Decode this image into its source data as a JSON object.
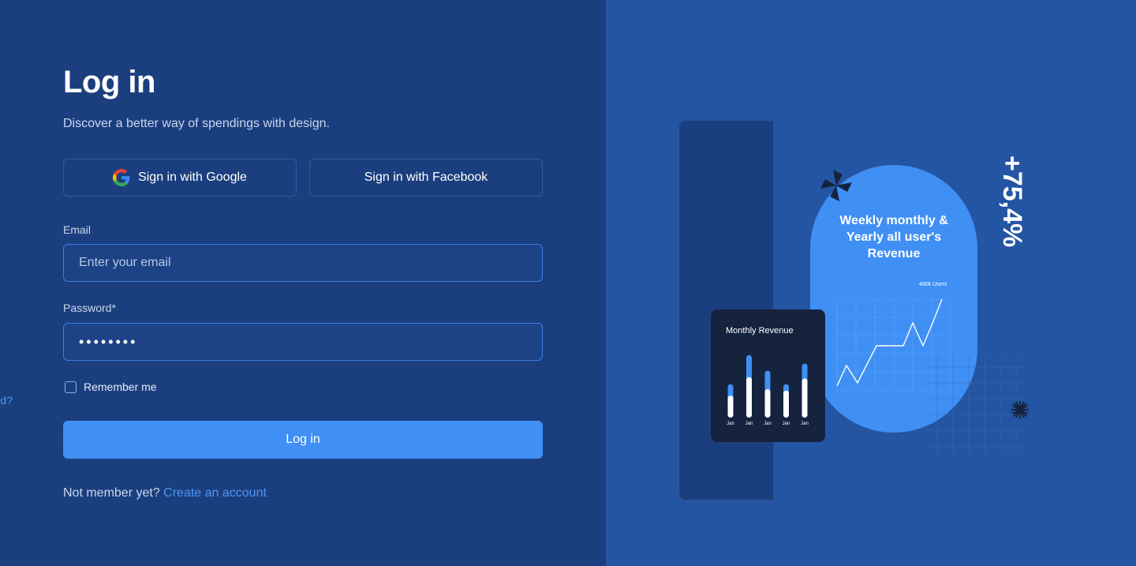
{
  "login": {
    "title": "Log in",
    "subtitle": "Discover a better way of spendings with design.",
    "google_label": "Sign in with Google",
    "facebook_label": "Sign in with Facebook",
    "email_label": "Email",
    "email_placeholder": "Enter your email",
    "password_label": "Password*",
    "password_value": "••••••••",
    "remember_label": "Remember me",
    "remember_checked": false,
    "forgot_label": "Forget password?",
    "submit_label": "Log in",
    "signup_prompt": "Not member yet?",
    "signup_link": "Create an account"
  },
  "illustration": {
    "growth": "+75,4%",
    "pill_title_lines": [
      "Weekly monthly &",
      "Yearly all user's",
      "Revenue"
    ],
    "pill_tag": "480k Users",
    "card_title": "Monthly Revenue",
    "card_bars": [
      {
        "label": "Jan",
        "total": 0.47,
        "white": 0.31
      },
      {
        "label": "Jan",
        "total": 0.88,
        "white": 0.57
      },
      {
        "label": "Jan",
        "total": 0.66,
        "white": 0.4
      },
      {
        "label": "Jan",
        "total": 0.47,
        "white": 0.38
      },
      {
        "label": "Jan",
        "total": 0.76,
        "white": 0.55
      }
    ]
  },
  "colors": {
    "left_bg": "#1b3f7e",
    "right_bg": "#2455a3",
    "accent": "#3f8ff5",
    "link": "#4b95f5",
    "card_bg": "#15233f"
  }
}
